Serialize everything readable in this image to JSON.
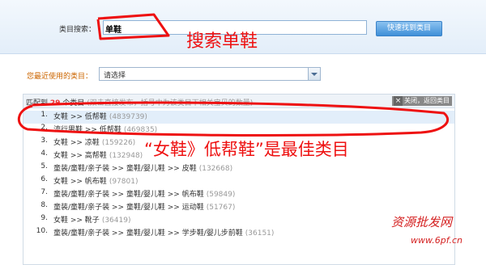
{
  "search": {
    "label": "类目搜索：",
    "value": "单鞋",
    "button_label": "快速找到类目"
  },
  "recent": {
    "label": "您最近使用的类目：",
    "select_value": "请选择"
  },
  "results": {
    "count_prefix": "匹配到",
    "count": "29",
    "count_suffix": "个类目",
    "hint": "(双击直接发布，括号中为该类目下相关宝贝的数量)",
    "close_label": "关闭，返回类目",
    "rows": [
      {
        "idx": "1.",
        "path": "女鞋 >> 低帮鞋",
        "count": "(4839739)"
      },
      {
        "idx": "2.",
        "path": "流行男鞋 >> 低帮鞋",
        "count": "(469835)"
      },
      {
        "idx": "3.",
        "path": "女鞋 >> 凉鞋",
        "count": "(159226)"
      },
      {
        "idx": "4.",
        "path": "女鞋 >> 高帮鞋",
        "count": "(132948)"
      },
      {
        "idx": "5.",
        "path": "童装/童鞋/亲子装 >> 童鞋/婴儿鞋 >> 皮鞋",
        "count": "(132668)"
      },
      {
        "idx": "6.",
        "path": "女鞋 >> 帆布鞋",
        "count": "(97801)"
      },
      {
        "idx": "7.",
        "path": "童装/童鞋/亲子装 >> 童鞋/婴儿鞋 >> 帆布鞋",
        "count": "(59849)"
      },
      {
        "idx": "8.",
        "path": "童装/童鞋/亲子装 >> 童鞋/婴儿鞋 >> 运动鞋",
        "count": "(51767)"
      },
      {
        "idx": "9.",
        "path": "女鞋 >> 靴子",
        "count": "(36419)"
      },
      {
        "idx": "10.",
        "path": "童装/童鞋/亲子装 >> 童鞋/婴儿鞋 >> 学步鞋/婴儿步前鞋",
        "count": "(36151)"
      }
    ]
  },
  "annotations": {
    "search_note": "搜索单鞋",
    "best_note": "“女鞋》低帮鞋”是最佳类目",
    "color": "#ee1111"
  },
  "watermark": {
    "text": "资源批发网",
    "url": "www.6pf.cn",
    "color": "#d42020"
  }
}
